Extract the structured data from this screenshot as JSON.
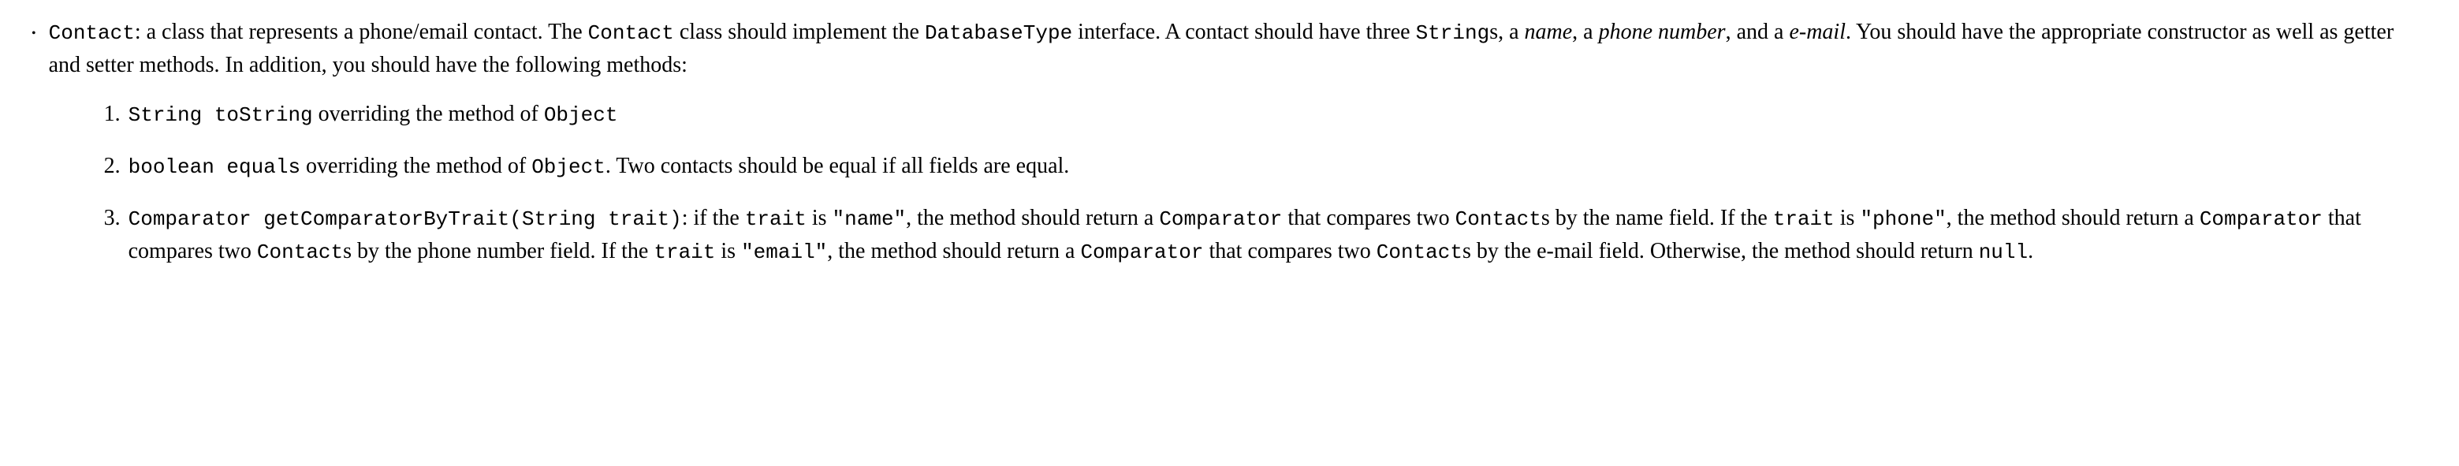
{
  "bullet": "•",
  "main": {
    "code1": "Contact",
    "text1": ": a class that represents a phone/email contact. The ",
    "code2": "Contact",
    "text2": " class should implement the ",
    "code3": "DatabaseType",
    "text3": " interface. A contact should have three ",
    "code4": "String",
    "text4": "s, a ",
    "em1": "name",
    "text5": ", a ",
    "em2": "phone number",
    "text6": ", and a ",
    "em3": "e-mail",
    "text7": ". You should have the appropriate constructor as well as getter and setter methods. In addition, you should have the following methods:"
  },
  "items": [
    {
      "num": "1.",
      "code1": "String toString",
      "text1": " overriding the method of ",
      "code2": "Object"
    },
    {
      "num": "2.",
      "code1": "boolean equals",
      "text1": " overriding the method of ",
      "code2": "Object",
      "text2": ". Two contacts should be equal if all fields are equal."
    },
    {
      "num": "3.",
      "code1": "Comparator getComparatorByTrait(String trait)",
      "text1": ": if the ",
      "code2": "trait",
      "text2": " is ",
      "code3": "\"name\"",
      "text3": ", the method should return a ",
      "code4": "Comparator",
      "text4": " that compares two ",
      "code5": "Contact",
      "text5": "s by the name field. If the ",
      "code6": "trait",
      "text6": " is ",
      "code7": "\"phone\"",
      "text7": ", the method should return a ",
      "code8": "Comparator",
      "text8": " that compares two ",
      "code9": "Contact",
      "text9": "s by the phone number field. If the ",
      "code10": "trait",
      "text10": " is ",
      "code11": "\"email\"",
      "text11": ", the method should return a ",
      "code12": "Comparator",
      "text12": " that compares two ",
      "code13": "Contact",
      "text13": "s by the e-mail field. Otherwise, the method should return ",
      "code14": "null",
      "text14": "."
    }
  ]
}
